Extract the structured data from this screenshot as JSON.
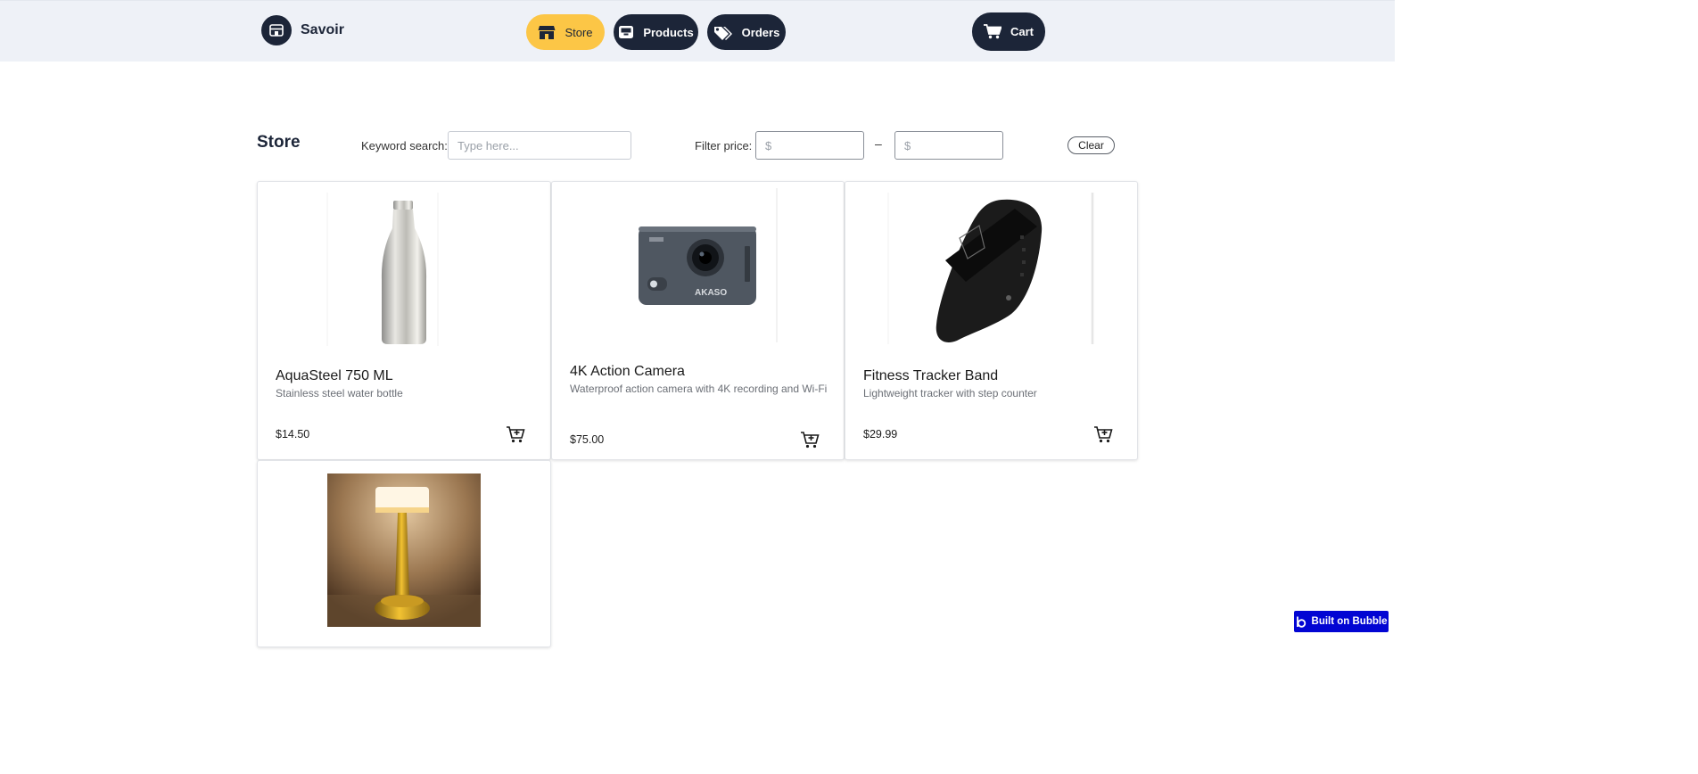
{
  "header": {
    "brand_name": "Savoir",
    "nav": [
      {
        "label": "Store",
        "icon": "store-icon",
        "active": true
      },
      {
        "label": "Products",
        "icon": "inbox-icon",
        "active": false
      },
      {
        "label": "Orders",
        "icon": "tags-icon",
        "active": false
      }
    ],
    "cart_label": "Cart",
    "colors": {
      "active": "#fcc646",
      "dark": "#1c2538",
      "bar": "#eef1f7"
    }
  },
  "filters": {
    "title": "Store",
    "keyword_label": "Keyword search:",
    "keyword_placeholder": "Type here...",
    "price_label": "Filter price:",
    "min_placeholder": "$",
    "max_placeholder": "$",
    "dash": "–",
    "clear_label": "Clear"
  },
  "products": [
    {
      "name": "AquaSteel 750 ML",
      "description": "Stainless steel water bottle",
      "price": "$14.50",
      "image": "bottle"
    },
    {
      "name": "4K Action Camera",
      "description": "Waterproof action camera with 4K recording and Wi-Fi",
      "price": "$75.00",
      "image": "camera",
      "image_text": "AKASO"
    },
    {
      "name": "Fitness Tracker Band",
      "description": "Lightweight tracker with step counter",
      "price": "$29.99",
      "image": "tracker"
    },
    {
      "name": "",
      "description": "",
      "price": "",
      "image": "lamp"
    }
  ],
  "footer": {
    "badge": "Built on Bubble"
  }
}
